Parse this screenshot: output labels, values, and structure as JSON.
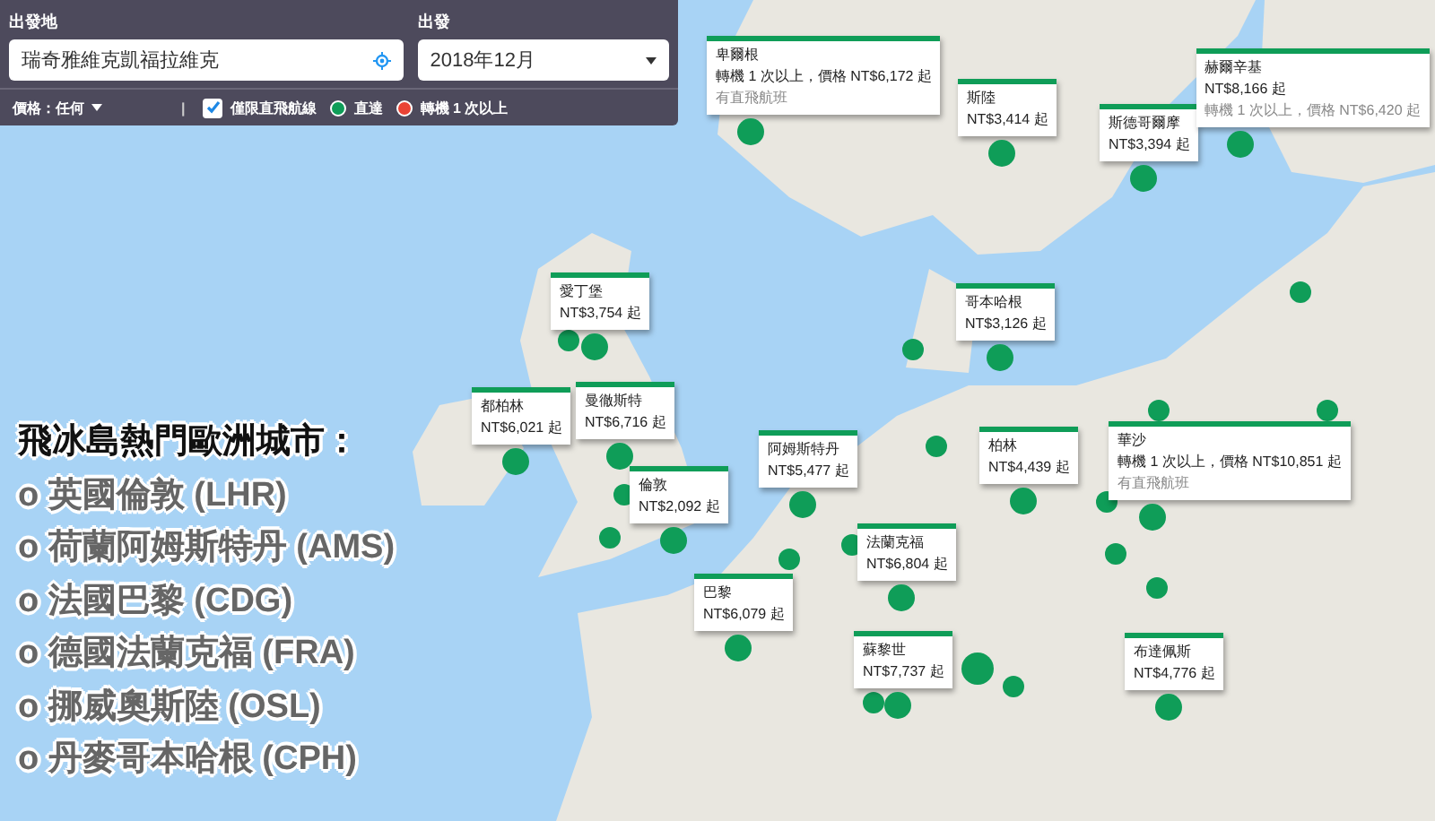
{
  "search_panel": {
    "origin_label": "出發地",
    "origin_value": "瑞奇雅維克凱福拉維克",
    "date_label": "出發",
    "date_value": "2018年12月",
    "price_filter": "價格：任何",
    "separator": "|",
    "direct_only": {
      "label": "僅限直飛航線",
      "checked": true
    },
    "legend": [
      {
        "label": "直達",
        "color": "#0f9d58"
      },
      {
        "label": "轉機 1 次以上",
        "color": "#ea4335"
      }
    ]
  },
  "popups": [
    {
      "title": "卑爾根",
      "lines": [
        {
          "text": "轉機 1 次以上，價格 NT$6,172 起",
          "muted": false
        },
        {
          "text": "有直飛航班",
          "muted": true
        }
      ]
    },
    {
      "title": "斯陸",
      "lines": [
        {
          "text": "NT$3,414 起",
          "muted": false
        }
      ]
    },
    {
      "title": "斯德哥爾摩",
      "lines": [
        {
          "text": "NT$3,394 起",
          "muted": false
        }
      ]
    },
    {
      "title": "赫爾辛基",
      "lines": [
        {
          "text": "NT$8,166 起",
          "muted": false
        },
        {
          "text": "轉機 1 次以上，價格 NT$6,420 起",
          "muted": true
        }
      ]
    },
    {
      "title": "愛丁堡",
      "lines": [
        {
          "text": "NT$3,754 起",
          "muted": false
        }
      ]
    },
    {
      "title": "哥本哈根",
      "lines": [
        {
          "text": "NT$3,126 起",
          "muted": false
        }
      ]
    },
    {
      "title": "都柏林",
      "lines": [
        {
          "text": "NT$6,021 起",
          "muted": false
        }
      ]
    },
    {
      "title": "曼徹斯特",
      "lines": [
        {
          "text": "NT$6,716 起",
          "muted": false
        }
      ]
    },
    {
      "title": "倫敦",
      "lines": [
        {
          "text": "NT$2,092 起",
          "muted": false
        }
      ]
    },
    {
      "title": "阿姆斯特丹",
      "lines": [
        {
          "text": "NT$5,477 起",
          "muted": false
        }
      ]
    },
    {
      "title": "柏林",
      "lines": [
        {
          "text": "NT$4,439 起",
          "muted": false
        }
      ]
    },
    {
      "title": "華沙",
      "lines": [
        {
          "text": "轉機 1 次以上，價格 NT$10,851 起",
          "muted": false
        },
        {
          "text": "有直飛航班",
          "muted": true
        }
      ]
    },
    {
      "title": "法蘭克福",
      "lines": [
        {
          "text": "NT$6,804 起",
          "muted": false
        }
      ]
    },
    {
      "title": "巴黎",
      "lines": [
        {
          "text": "NT$6,079 起",
          "muted": false
        }
      ]
    },
    {
      "title": "蘇黎世",
      "lines": [
        {
          "text": "NT$7,737 起",
          "muted": false
        }
      ]
    },
    {
      "title": "布達佩斯",
      "lines": [
        {
          "text": "NT$4,776 起",
          "muted": false
        }
      ]
    }
  ],
  "overlay": {
    "title": "飛冰島熱門歐洲城市：",
    "items": [
      "o 英國倫敦 (LHR)",
      "o 荷蘭阿姆斯特丹 (AMS)",
      "o 法國巴黎 (CDG)",
      "o 德國法蘭克福 (FRA)",
      "o 挪威奧斯陸 (OSL)",
      "o 丹麥哥本哈根 (CPH)"
    ]
  }
}
